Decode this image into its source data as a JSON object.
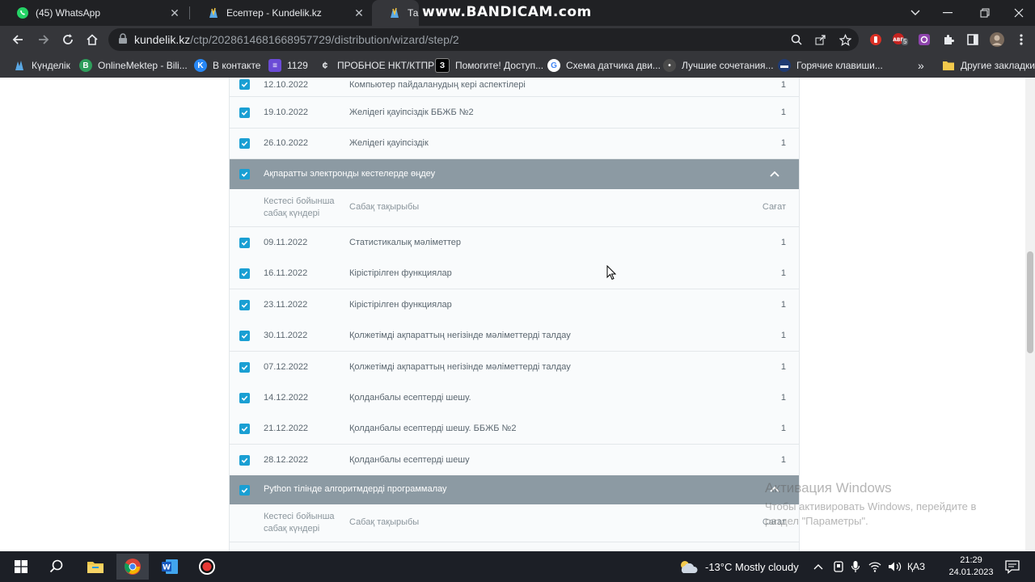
{
  "browser": {
    "tabs": [
      {
        "label": "(45) WhatsApp",
        "active": false
      },
      {
        "label": "Есептер - Kundelik.kz",
        "active": false
      },
      {
        "label": "Тақыр",
        "active": true
      }
    ],
    "overlay_text": "www.BANDICAM.com",
    "url_host": "kundelik.kz",
    "url_path": "/ctp/2028614681668957729/distribution/wizard/step/2",
    "bookmarks": [
      "Күнделік",
      "OnlineMektep - Bili...",
      "В контакте",
      "1129",
      "ПРОБНОЕ НКТ/КТПР",
      "Помогите! Доступ...",
      "Схема датчика дви...",
      "Лучшие сочетания...",
      "Горячие клавиши..."
    ],
    "other_bookmarks": "Другие закладки",
    "ext_badge": "5"
  },
  "table": {
    "rows_top": [
      {
        "date": "12.10.2022",
        "topic": "Компьютер пайдаланудың кері аспектілері",
        "hours": "1"
      },
      {
        "date": "19.10.2022",
        "topic": "Желідегі қауіпсіздік ББЖБ №2",
        "hours": "1"
      },
      {
        "date": "26.10.2022",
        "topic": "Желідегі қауіпсіздік",
        "hours": "1"
      }
    ],
    "sections": [
      {
        "title": "Ақпаратты электронды кестелерде өңдеу"
      },
      {
        "title": "Python тілінде алгоритмдерді программалау"
      }
    ],
    "header": {
      "date_col": "Кестесі бойынша сабақ күндері",
      "topic_col": "Сабақ тақырыбы",
      "hours_col": "Сағат"
    },
    "rows_section1": [
      {
        "date": "09.11.2022",
        "topic": "Статистикалық мәліметтер",
        "hours": "1"
      },
      {
        "date": "16.11.2022",
        "topic": "Кірістірілген функциялар",
        "hours": "1"
      },
      {
        "date": "23.11.2022",
        "topic": "Кірістірілген функциялар",
        "hours": "1"
      },
      {
        "date": "30.11.2022",
        "topic": "Қолжетімді ақпараттың негізінде мәліметтерді талдау",
        "hours": "1"
      },
      {
        "date": "07.12.2022",
        "topic": "Қолжетімді ақпараттың негізінде мәліметтерді талдау",
        "hours": "1"
      },
      {
        "date": "14.12.2022",
        "topic": "Қолданбалы есептерді шешу.",
        "hours": "1"
      },
      {
        "date": "21.12.2022",
        "topic": "Қолданбалы есептерді шешу. ББЖБ №2",
        "hours": "1"
      },
      {
        "date": "28.12.2022",
        "topic": "Қолданбалы есептерді шешу",
        "hours": "1"
      }
    ]
  },
  "watermark": {
    "line1": "Активация Windows",
    "line2": "Чтобы активировать Windows, перейдите в раздел \"Параметры\"."
  },
  "taskbar": {
    "weather": "-13°C  Mostly cloudy",
    "language": "ҚАЗ",
    "time": "21:29",
    "date": "24.01.2023"
  },
  "colors": {
    "accent": "#1a9fd3",
    "section_bg": "#8c9aa3"
  }
}
